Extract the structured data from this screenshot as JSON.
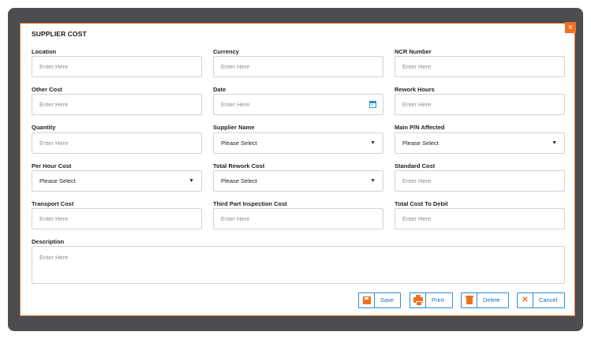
{
  "dialog": {
    "title": "SUPPLIER COST",
    "close_glyph": "×"
  },
  "fields": {
    "location": {
      "label": "Location",
      "placeholder": "Enter Here"
    },
    "currency": {
      "label": "Currency",
      "placeholder": "Enter Here"
    },
    "ncr_number": {
      "label": "NCR Number",
      "placeholder": "Enter Here"
    },
    "other_cost": {
      "label": "Other Cost",
      "placeholder": "Enter Here"
    },
    "date": {
      "label": "Date",
      "placeholder": "Enter Here"
    },
    "rework_hours": {
      "label": "Rework Hours",
      "placeholder": "Enter Here"
    },
    "quantity": {
      "label": "Quantity",
      "placeholder": "Enter Here"
    },
    "supplier_name": {
      "label": "Supplier Name",
      "value": "Please Select"
    },
    "main_pn_affected": {
      "label": "Main P/N Affected",
      "value": "Please Select"
    },
    "per_hour_cost": {
      "label": "Per Hour Cost",
      "value": "Please Select"
    },
    "total_rework_cost": {
      "label": "Total Rework Cost",
      "value": "Please Select"
    },
    "standard_cost": {
      "label": "Standard Cost",
      "placeholder": "Enter Here"
    },
    "transport_cost": {
      "label": "Transport  Cost",
      "placeholder": "Enter Here"
    },
    "third_part_inspection_cost": {
      "label": "Third Part Inspection Cost",
      "placeholder": "Enter Here"
    },
    "total_cost_to_debit": {
      "label": "Total Cost To Debit",
      "placeholder": "Enter Here"
    },
    "description": {
      "label": "Description",
      "placeholder": "Enter Here"
    }
  },
  "actions": {
    "save": "Save",
    "print": "Print",
    "delete": "Delete",
    "cancel": "Cancel"
  },
  "icons": {
    "close": "close-icon",
    "calendar": "calendar-icon",
    "dropdown": "chevron-down-icon",
    "save": "floppy-disk-icon",
    "print": "printer-icon",
    "delete": "trash-icon",
    "cancel": "x-icon"
  },
  "colors": {
    "accent": "#f26f1f",
    "button_border": "#2e8ed6",
    "backdrop": "#4b4d50"
  }
}
